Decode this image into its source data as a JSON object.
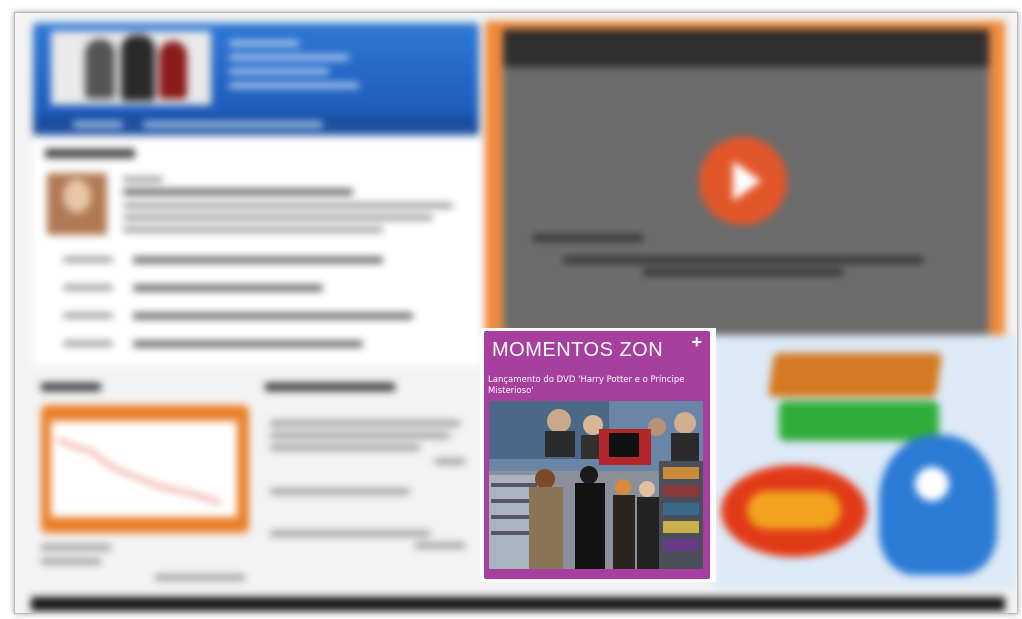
{
  "card": {
    "title": "MOMENTOS ZON",
    "plus_icon": "+",
    "subtitle": "Lançamento do DVD 'Harry Potter e o Príncipe Misterioso'",
    "photo_icon": "photo-event-image"
  },
  "colors": {
    "card_bg": "#a63f9e",
    "header_blue": "#2f78d4",
    "video_frame": "#f08a3c",
    "play_button": "#e3562a"
  }
}
